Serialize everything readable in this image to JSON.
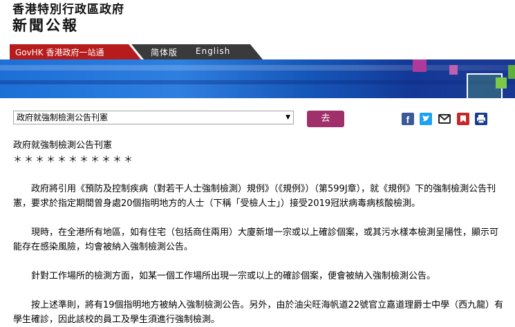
{
  "header": {
    "line1": "香港特別行政區政府",
    "line2": "新聞公報"
  },
  "nav": {
    "gov_link": "GovHK 香港政府一站通",
    "simplified": "简体版",
    "english": "English"
  },
  "toolbar": {
    "select_value": "政府就強制檢測公告刊憲",
    "go_label": "去"
  },
  "share_icons": [
    "facebook-icon",
    "twitter-icon",
    "email-icon",
    "bookmark-icon",
    "print-icon"
  ],
  "colors": {
    "nav_red": "#b71c1c",
    "go_button": "#a0306a",
    "banner_blue": "#1d6fd6"
  },
  "article": {
    "title": "政府就強制檢測公告刊憲",
    "stars": "＊＊＊＊＊＊＊＊＊＊＊",
    "paragraphs": [
      "政府將引用《預防及控制疾病（對若干人士強制檢測）規例》（《規例》）（第599J章），就《規例》下的強制檢測公告刊憲，要求於指定期間曾身處20個指明地方的人士（下稱「受檢人士」）接受2019冠狀病毒病核酸檢測。",
      "現時，在全港所有地區，如有住宅（包括商住兩用）大廈新增一宗或以上確診個案，或其污水樣本檢測呈陽性，顯示可能存在感染風險，均會被納入強制檢測公告。",
      "針對工作場所的檢測方面，如某一個工作場所出現一宗或以上的確診個案，便會被納入強制檢測公告。",
      "按上述準則，將有19個指明地方被納入強制檢測公告。另外，由於油尖旺海帆道22號官立嘉道理爵士中學（西九龍）有學生確診，因此該校的員工及學生須進行強制檢測。"
    ]
  }
}
